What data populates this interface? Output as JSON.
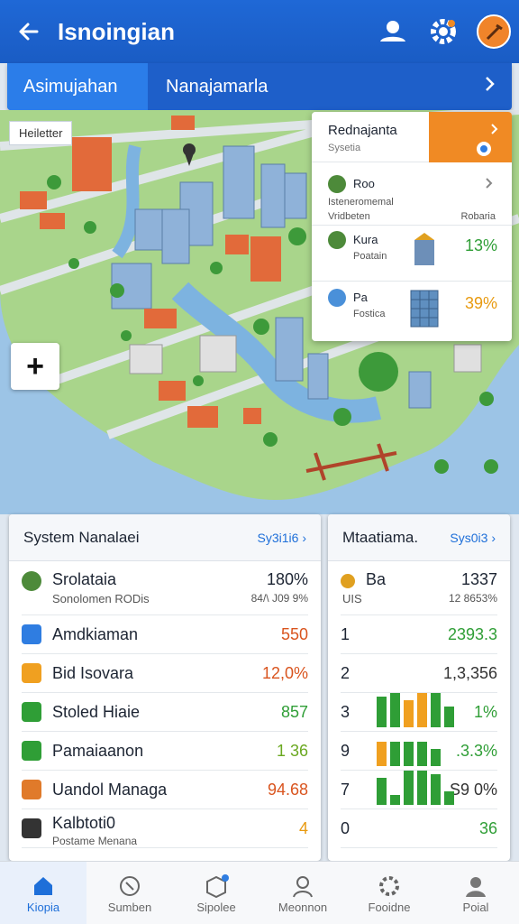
{
  "header": {
    "title": "Isnoingian"
  },
  "tabs": {
    "active": "Asimujahan",
    "other": "Nanajamarla"
  },
  "map": {
    "label": "Heiletter"
  },
  "popup": {
    "title": "Rednajanta",
    "subtitle": "Sysetia",
    "rows": [
      {
        "name": "Roo",
        "sub1": "Isteneromemal",
        "sub2": "Vridbeten",
        "right": "Robaria"
      },
      {
        "name": "Kura",
        "sub1": "Poatain",
        "value": "13%"
      },
      {
        "name": "Pa",
        "sub1": "Fostica",
        "value": "39%"
      }
    ]
  },
  "left_panel": {
    "title": "System Nanalaei",
    "link": "Sy3i1i6",
    "first": {
      "label": "Srolataia",
      "sub": "Sonolomen  RODis",
      "value": "180%",
      "sub_value": "84/\\ J09 9%"
    },
    "rows": [
      {
        "label": "Amdkiaman",
        "value": "550",
        "color": "#d9541e",
        "icon": "#2f7de1"
      },
      {
        "label": "Bid Isovara",
        "value": "12,0%",
        "color": "#d9541e",
        "icon": "#f0a020"
      },
      {
        "label": "Stoled Hiaie",
        "value": "857",
        "color": "#2f9e36",
        "icon": "#2f9e36"
      },
      {
        "label": "Pamaiaanon",
        "value": "1 36",
        "color": "#6aa820",
        "icon": "#2f9e36"
      },
      {
        "label": "Uandol Managa",
        "value": "94.68",
        "color": "#d9541e",
        "icon": "#e07a2a"
      },
      {
        "label": "Kalbtoti0",
        "sub": "Postame Menana",
        "value": "4",
        "color": "#e89a10",
        "icon": "#333333"
      }
    ]
  },
  "right_panel": {
    "title": "Mtaatiama.",
    "link": "Sys0i3",
    "first": {
      "label": "Ba",
      "sub": "UIS",
      "value": "1337",
      "sub_value": "12 8653%"
    },
    "rows": [
      {
        "label": "1",
        "value": "2393.3",
        "color": "#2f9e36"
      },
      {
        "label": "2",
        "value": "1,3,356",
        "color": "#333333"
      },
      {
        "label": "3",
        "value": "1%",
        "color": "#2f9e36"
      },
      {
        "label": "9",
        "value": ".3.3%",
        "color": "#2f9e36"
      },
      {
        "label": "7",
        "value": "S9 0%",
        "color": "#333333"
      },
      {
        "label": "0",
        "value": "36",
        "color": "#2f9e36"
      }
    ]
  },
  "nav": [
    {
      "label": "Kiopia",
      "icon": "home-icon"
    },
    {
      "label": "Sumben",
      "icon": "compass-icon"
    },
    {
      "label": "Sipolee",
      "icon": "box-icon"
    },
    {
      "label": "Meonnon",
      "icon": "person-icon"
    },
    {
      "label": "Fooidne",
      "icon": "gear-icon"
    },
    {
      "label": "Poial",
      "icon": "profile-icon"
    }
  ]
}
